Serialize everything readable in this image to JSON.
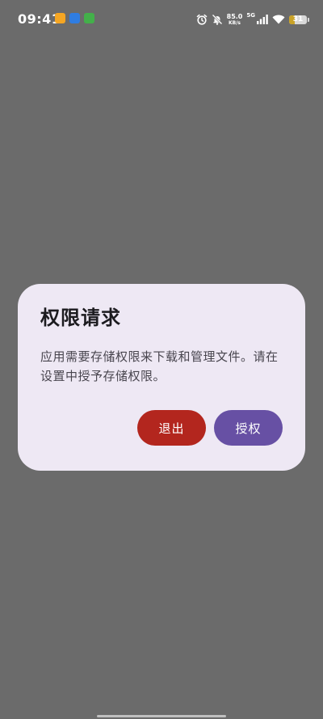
{
  "status_bar": {
    "time": "09:41",
    "net_speed_value": "85.0",
    "net_speed_unit": "KB/s",
    "network_type": "5G",
    "battery_level": "31",
    "app_icons": [
      "notification-app-icon-orange",
      "notification-app-icon-blue",
      "notification-app-icon-green"
    ],
    "colors": {
      "app_orange": "#f5a623",
      "app_blue": "#2f7de1",
      "app_green": "#43b04a",
      "battery_fill": "#c9a227"
    }
  },
  "dialog": {
    "title": "权限请求",
    "message": "应用需要存储权限来下载和管理文件。请在设置中授予存储权限。",
    "exit_label": "退出",
    "grant_label": "授权",
    "colors": {
      "background": "#eee8f4",
      "exit_button": "#b3261e",
      "grant_button": "#6750a4"
    }
  },
  "backdrop_color": "#6b6b6b"
}
